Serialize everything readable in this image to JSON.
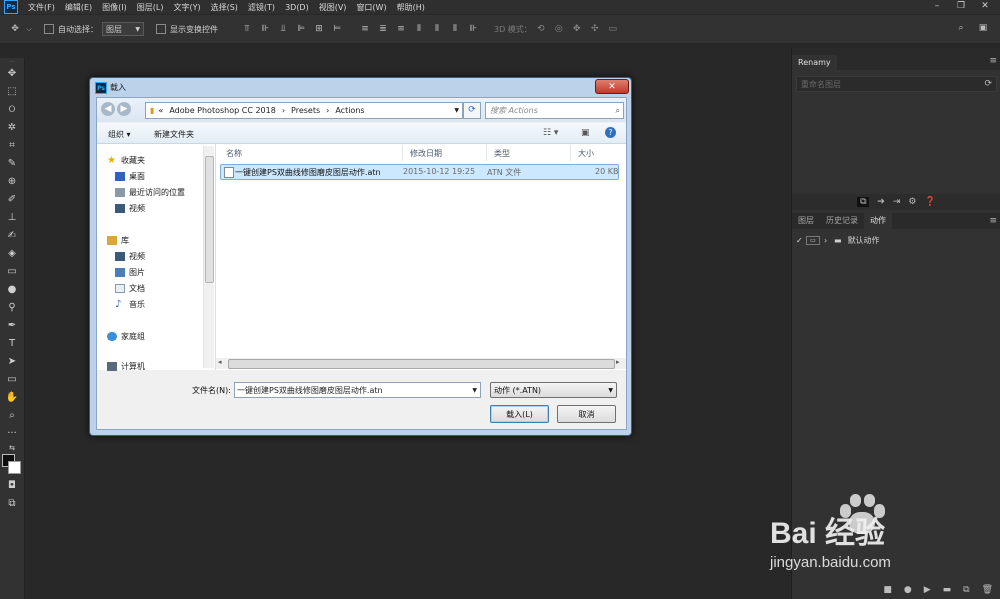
{
  "app": {
    "logo": "Ps"
  },
  "menubar": {
    "items": [
      "文件(F)",
      "编辑(E)",
      "图像(I)",
      "图层(L)",
      "文字(Y)",
      "选择(S)",
      "滤镜(T)",
      "3D(D)",
      "视图(V)",
      "窗口(W)",
      "帮助(H)"
    ]
  },
  "options": {
    "auto_select_label": "自动选择：",
    "auto_select_value": "图层",
    "transform_label": "显示变换控件",
    "mode_3d_label": "3D 模式："
  },
  "panel": {
    "renamy_tab": "Renamy",
    "rename_placeholder": "重命名图层",
    "tabs": [
      "图层",
      "历史记录",
      "动作"
    ],
    "action_set": "默认动作"
  },
  "dialog": {
    "title": "载入",
    "breadcrumb": [
      "«",
      "Adobe Photoshop CC 2018",
      "Presets",
      "Actions"
    ],
    "search_placeholder": "搜索 Actions",
    "organize_label": "组织 ▾",
    "new_folder_label": "新建文件夹",
    "nav": {
      "favorites": "收藏夹",
      "desktop": "桌面",
      "recent": "最近访问的位置",
      "videos": "视频",
      "libraries": "库",
      "lib_videos": "视频",
      "pictures": "图片",
      "documents": "文档",
      "music": "音乐",
      "homegroup": "家庭组",
      "computer": "计算机"
    },
    "columns": [
      "名称",
      "修改日期",
      "类型",
      "大小"
    ],
    "files": [
      {
        "name": "一键创建PS双曲线修图磨皮图层动作.atn",
        "date": "2015-10-12 19:25",
        "type": "ATN 文件",
        "size": "20 KB"
      }
    ],
    "filename_label": "文件名(N):",
    "filename_value": "一键创建PS双曲线修图磨皮图层动作.atn",
    "filetype_value": "动作 (*.ATN)",
    "load_button": "载入(L)",
    "cancel_button": "取消"
  },
  "watermark": {
    "brand": "Bai 经验",
    "url": "jingyan.baidu.com"
  },
  "colors": {
    "ps_bg": "#282828",
    "panel": "#323232",
    "dialog_frame": "#bcd2ea",
    "selection": "#cce8ff",
    "accent": "#31a8ff"
  }
}
